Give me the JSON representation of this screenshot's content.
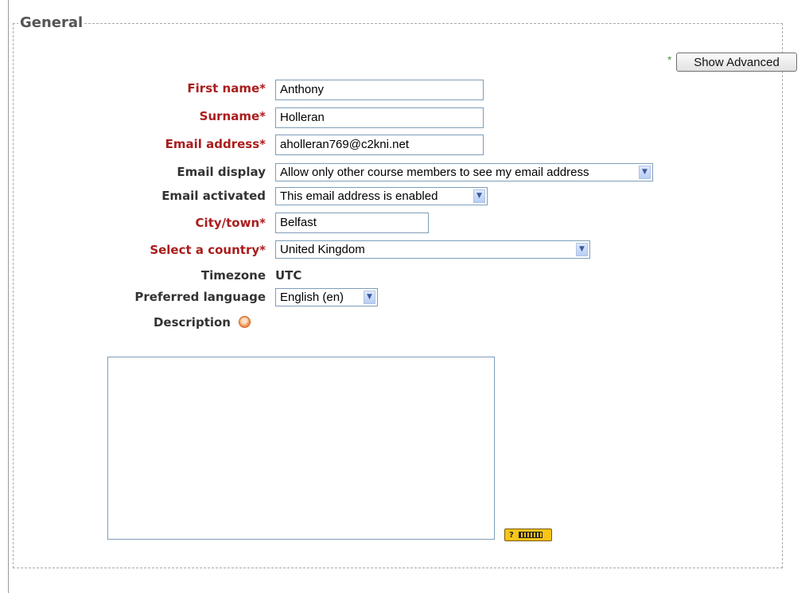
{
  "section": {
    "legend": "General",
    "show_advanced_marker": "*",
    "show_advanced_label": "Show Advanced"
  },
  "form": {
    "first_name": {
      "label": "First name",
      "required_marker": "*",
      "value": "Anthony"
    },
    "surname": {
      "label": "Surname",
      "required_marker": "*",
      "value": "Holleran"
    },
    "email": {
      "label": "Email address",
      "required_marker": "*",
      "value": "aholleran769@c2kni.net"
    },
    "email_display": {
      "label": "Email display",
      "value": "Allow only other course members to see my email address"
    },
    "email_activated": {
      "label": "Email activated",
      "value": "This email address is enabled"
    },
    "city": {
      "label": "City/town",
      "required_marker": "*",
      "value": "Belfast"
    },
    "country": {
      "label": "Select a country",
      "required_marker": "*",
      "value": "United Kingdom"
    },
    "timezone": {
      "label": "Timezone",
      "value": "UTC"
    },
    "language": {
      "label": "Preferred language",
      "value": "English (en)"
    },
    "description": {
      "label": "Description",
      "value": ""
    }
  },
  "icons": {
    "help": "help-icon",
    "keyboard": "keyboard-help-icon",
    "dropdown": "chevron-down-icon",
    "keyboard_help_text": "?"
  },
  "colors": {
    "required_label": "#aa1d1d",
    "normal_label": "#333333",
    "field_border": "#7f9db9",
    "advanced_marker": "#4a9a4a"
  }
}
